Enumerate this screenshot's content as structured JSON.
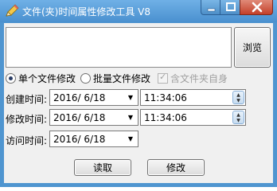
{
  "window": {
    "title": "文件(夹)时间属性修改工具 V8",
    "icons": {
      "app": "pencil-icon",
      "minimize": "minimize-icon",
      "maximize": "maximize-icon",
      "close": "close-icon"
    }
  },
  "browse_label": "浏览",
  "mode": {
    "single_label": "单个文件修改",
    "single_checked": true,
    "batch_label": "批量文件修改",
    "batch_checked": false,
    "include_folder_label": "含文件夹自身",
    "include_folder_checked": true,
    "include_folder_disabled": true
  },
  "rows": {
    "created": {
      "label": "创建时间:",
      "date": "2016/ 6/18",
      "time": "11:34:06"
    },
    "modified": {
      "label": "修改时间:",
      "date": "2016/ 6/18",
      "time": "11:34:06"
    },
    "accessed": {
      "label": "访问时间:",
      "date": "2016/ 6/18"
    }
  },
  "actions": {
    "read_label": "读取",
    "modify_label": "修改"
  },
  "colors": {
    "titlebar": "#4f95d0",
    "close_button": "#c4402a",
    "client_bg": "#f0f0f0"
  }
}
